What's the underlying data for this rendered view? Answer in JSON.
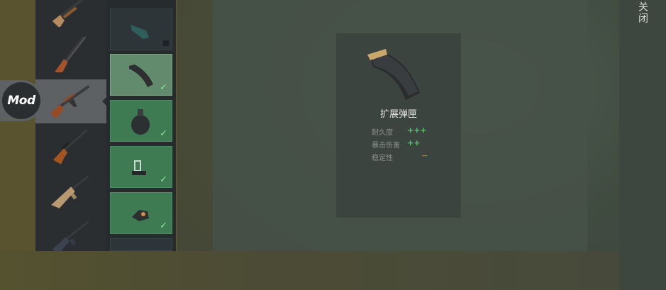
{
  "close_label": "关闭",
  "mod_badge": "Mod",
  "weapons": [
    {
      "icon": "shotgun-icon"
    },
    {
      "icon": "double-barrel-icon"
    },
    {
      "icon": "ak-rifle-icon",
      "selected": true
    },
    {
      "icon": "dragunov-icon"
    },
    {
      "icon": "assault-rifle-icon"
    },
    {
      "icon": "m4-rifle-icon"
    }
  ],
  "mod_slots": [
    {
      "icon": "grip-icon",
      "state": "locked"
    },
    {
      "icon": "extended-magazine-icon",
      "state": "active",
      "checked": true
    },
    {
      "icon": "drum-magazine-icon",
      "state": "owned",
      "checked": true
    },
    {
      "icon": "holo-sight-icon",
      "state": "owned",
      "checked": true
    },
    {
      "icon": "red-dot-sight-icon",
      "state": "owned",
      "checked": true
    }
  ],
  "detail": {
    "name": "扩展弹匣",
    "icon": "extended-magazine-icon",
    "stats": [
      {
        "label": "耐久度",
        "value": "+++",
        "color": "#4fd35f"
      },
      {
        "label": "暴击伤害",
        "value": "++",
        "color": "#4fd35f"
      },
      {
        "label": "稳定性",
        "value": "−",
        "color": "#d9643a"
      }
    ]
  }
}
